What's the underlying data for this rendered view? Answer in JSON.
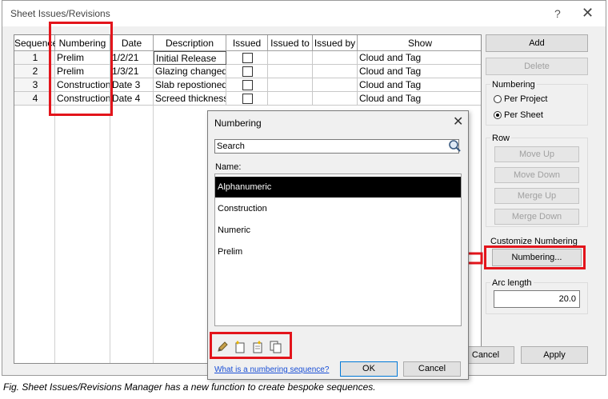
{
  "window": {
    "title": "Sheet Issues/Revisions",
    "help_glyph": "?",
    "close_glyph": "✕"
  },
  "table": {
    "headers": [
      "Sequence",
      "Numbering",
      "Date",
      "Description",
      "Issued",
      "Issued to",
      "Issued by",
      "Show"
    ],
    "rows": [
      {
        "sequence": "1",
        "numbering": "Prelim",
        "date": "1/2/21",
        "description": "Initial Release",
        "issued": false,
        "issued_to": "",
        "issued_by": "",
        "show": "Cloud and Tag"
      },
      {
        "sequence": "2",
        "numbering": "Prelim",
        "date": "1/3/21",
        "description": "Glazing changed",
        "issued": false,
        "issued_to": "",
        "issued_by": "",
        "show": "Cloud and Tag"
      },
      {
        "sequence": "3",
        "numbering": "Construction",
        "date": "Date 3",
        "description": "Slab repostioned",
        "issued": false,
        "issued_to": "",
        "issued_by": "",
        "show": "Cloud and Tag"
      },
      {
        "sequence": "4",
        "numbering": "Construction",
        "date": "Date 4",
        "description": "Screed thickness i",
        "issued": false,
        "issued_to": "",
        "issued_by": "",
        "show": "Cloud and Tag"
      }
    ]
  },
  "panel": {
    "add_label": "Add",
    "delete_label": "Delete",
    "numbering_group_label": "Numbering",
    "per_project_label": "Per Project",
    "per_sheet_label": "Per Sheet",
    "selected_mode": "per_sheet",
    "row_group_label": "Row",
    "move_up_label": "Move Up",
    "move_down_label": "Move Down",
    "merge_up_label": "Merge Up",
    "merge_down_label": "Merge Down",
    "customize_label": "Customize Numbering",
    "numbering_button_label": "Numbering...",
    "arc_length_label": "Arc length",
    "arc_length_value": "20.0"
  },
  "footer": {
    "cancel_label": "Cancel",
    "apply_label": "Apply"
  },
  "dialog": {
    "title": "Numbering",
    "close_glyph": "✕",
    "search_placeholder": "Search",
    "name_label": "Name:",
    "items": [
      "Alphanumeric",
      "Construction",
      "Numeric",
      "Prelim"
    ],
    "selected_index": 0,
    "link_text": "What is a numbering sequence?",
    "ok_label": "OK",
    "cancel_label": "Cancel"
  },
  "caption": "Fig. Sheet Issues/Revisions Manager has a new function to create bespoke sequences.",
  "colors": {
    "highlight_red": "#e3141b",
    "link_blue": "#1a4fd6",
    "selection": "#000000"
  }
}
